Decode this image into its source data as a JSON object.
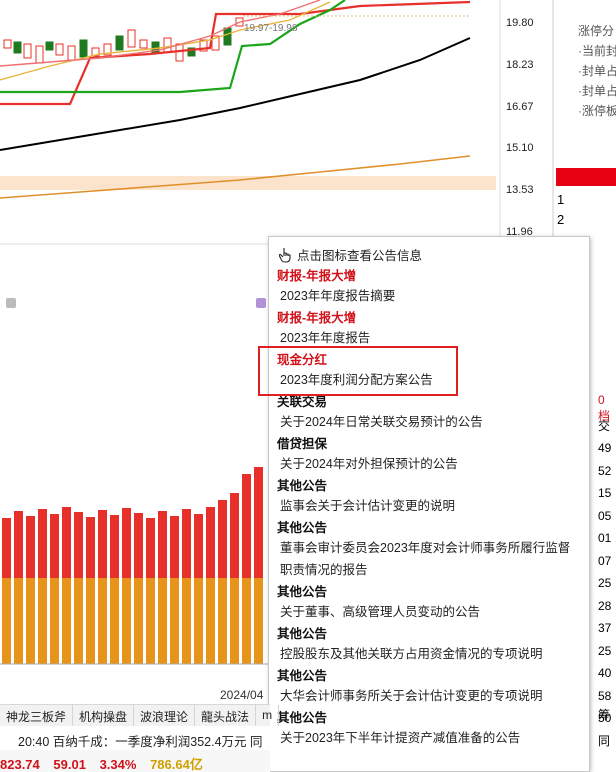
{
  "price_axis": [
    "19.80",
    "18.23",
    "16.67",
    "15.10",
    "13.53",
    "11.96"
  ],
  "range_label": "19.97-19.98",
  "date_label": "2024/04",
  "right_panel": {
    "notes": [
      "涨停分",
      "·当前封",
      "·封单占",
      "·封单占",
      "·涨停板"
    ],
    "row_numbers": [
      "1",
      "2"
    ],
    "side_header": "0档",
    "side_col_char": "交",
    "side_digits": [
      "49",
      "52",
      "15",
      "05",
      "01",
      "07",
      "25",
      "28",
      "37",
      "25",
      "40",
      "58",
      "50"
    ],
    "footer_char1": "筹",
    "footer_char2": "同"
  },
  "popup": {
    "hint": "点击图标查看公告信息",
    "items": [
      {
        "type": "财报-年报大增",
        "title": "2023年年度报告摘要",
        "red": true
      },
      {
        "type": "财报-年报大增",
        "title": "2023年年度报告",
        "red": true
      },
      {
        "type": "现金分红",
        "title": "2023年度利润分配方案公告",
        "red": true
      },
      {
        "type": "关联交易",
        "title": "关于2024年日常关联交易预计的公告",
        "red": false
      },
      {
        "type": "借贷担保",
        "title": "关于2024年对外担保预计的公告",
        "red": false
      },
      {
        "type": "其他公告",
        "title": "监事会关于会计估计变更的说明",
        "red": false
      },
      {
        "type": "其他公告",
        "title": "董事会审计委员会2023年度对会计师事务所履行监督职责情况的报告",
        "red": false
      },
      {
        "type": "其他公告",
        "title": "关于董事、高级管理人员变动的公告",
        "red": false
      },
      {
        "type": "其他公告",
        "title": "控股股东及其他关联方占用资金情况的专项说明",
        "red": false
      },
      {
        "type": "其他公告",
        "title": "大华会计师事务所关于会计估计变更的专项说明",
        "red": false
      },
      {
        "type": "其他公告",
        "title": "关于2023年下半年计提资产减值准备的公告",
        "red": false
      }
    ]
  },
  "tabs": [
    "神龙三板斧",
    "机构操盘",
    "波浪理论",
    "龍头战法",
    "m"
  ],
  "news": {
    "time": "20:40",
    "text": "百纳千成：一季度净利润352.4万元 同"
  },
  "status": {
    "v1": "823.74",
    "v2": "59.01",
    "v3": "3.34%",
    "v4": "786.64亿"
  },
  "colors": {
    "up": "#e8302a",
    "volume": "#e8941a",
    "highlight": "#e02020",
    "green_line": "#1aa51a",
    "black_line": "#000000",
    "orange_line": "#e0902a"
  }
}
